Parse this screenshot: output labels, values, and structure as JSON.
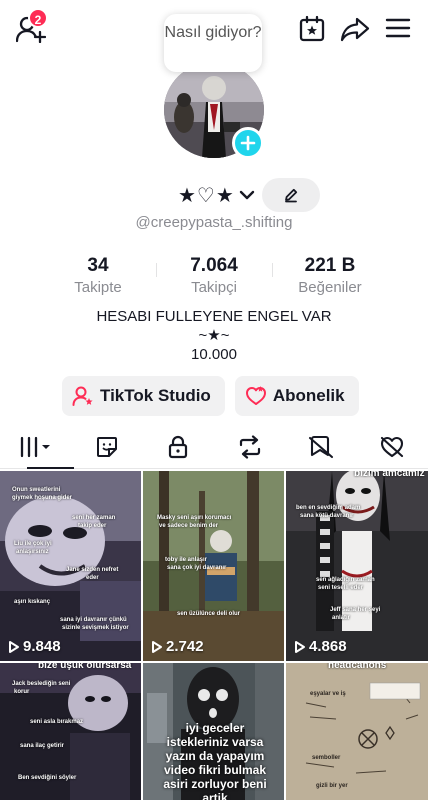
{
  "header": {
    "friend_request_count": "2",
    "speech_bubble": "Nasıl gidiyor?"
  },
  "profile": {
    "display_name": "★♡★",
    "username": "@creepypasta_.shifting"
  },
  "stats": [
    {
      "value": "34",
      "label": "Takipte"
    },
    {
      "value": "7.064",
      "label": "Takipçi"
    },
    {
      "value": "221 B",
      "label": "Beğeniler"
    }
  ],
  "bio": {
    "line1": "HESABI FULLEYENE ENGEL VAR",
    "line2": "~★~",
    "line3": "10.000"
  },
  "actions": {
    "studio_label": "TikTok Studio",
    "subscription_label": "Abonelik"
  },
  "tabs": [
    "videos-tab-icon",
    "stickers-tab-icon",
    "private-tab-icon",
    "reposts-tab-icon",
    "favorites-tab-icon",
    "liked-tab-icon"
  ],
  "videos": [
    {
      "views": "9.848",
      "captions": [
        "Onun sweatlerini",
        "giymek hoşuna gider",
        "seni her zaman",
        "takip eder",
        "Liu ile çok iyi",
        "anlaşırsınız",
        "Jane sizden nefret",
        "eder",
        "aşırı kıskanç",
        "sana iyi davranır çünkü",
        "sizinle sevişmek istiyor"
      ]
    },
    {
      "views": "2.742",
      "captions": [
        "Masky seni aşırı korumacı",
        "ve sadece benim der",
        "toby ile anlaşır",
        "sana çok iyi davranır",
        "sen üzülünce deli olur"
      ]
    },
    {
      "views": "4.868",
      "title": "bizim amcamız",
      "captions": [
        "ben en sevdiğim adam",
        "sana kötü davranır",
        "sen ağladığın zaman",
        "seni teselli eder",
        "Jeff sana her şeyi",
        "anlatır"
      ]
    },
    {
      "title": "bize üşük olursarsa",
      "captions": [
        "Jack beslediğin seni",
        "korur",
        "seni asla bırakmaz",
        "sana ilaç getirir",
        "Ben sevdiğini söyler"
      ]
    },
    {
      "caption": "iyi geceler istekleriniz varsa yazın da yapayım video fikri bulmak asiri zorluyor beni artik"
    },
    {
      "title": "headcanons",
      "captions": [
        "eşyalar ve iş",
        "semboller",
        "gizli bir yer"
      ]
    }
  ],
  "colors": {
    "accent": "#fe2c55",
    "plus": "#20d5ec",
    "text": "#161823",
    "muted": "#8a8b91"
  }
}
